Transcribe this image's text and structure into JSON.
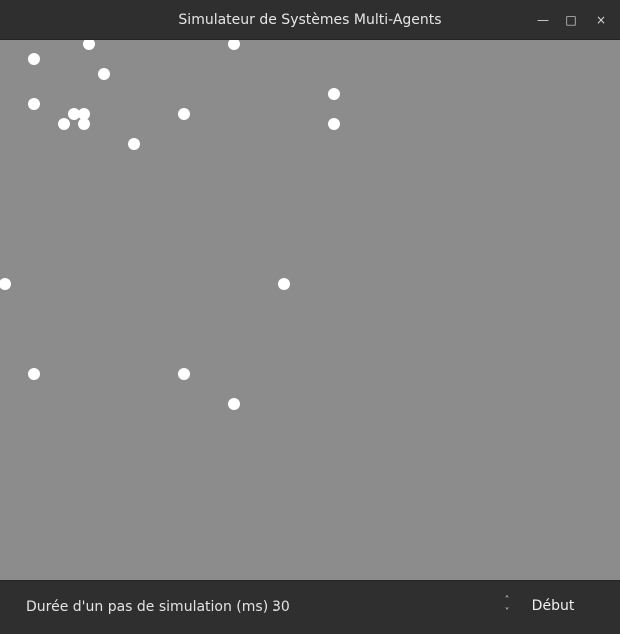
{
  "window": {
    "title": "Simulateur de Systèmes Multi-Agents",
    "controls": {
      "minimize_icon": "minimize-icon",
      "maximize_icon": "maximize-icon",
      "close_icon": "close-icon"
    }
  },
  "canvas": {
    "background_color": "#8c8c8c",
    "agent_color": "#ffffff",
    "agent_count": 18
  },
  "controls": {
    "step_duration_label": "Durée d'un pas de simulation (ms) :",
    "step_duration_value": "30",
    "spin_up_icon": "chevron-up-icon",
    "spin_down_icon": "chevron-down-icon",
    "start_label": "Début"
  }
}
